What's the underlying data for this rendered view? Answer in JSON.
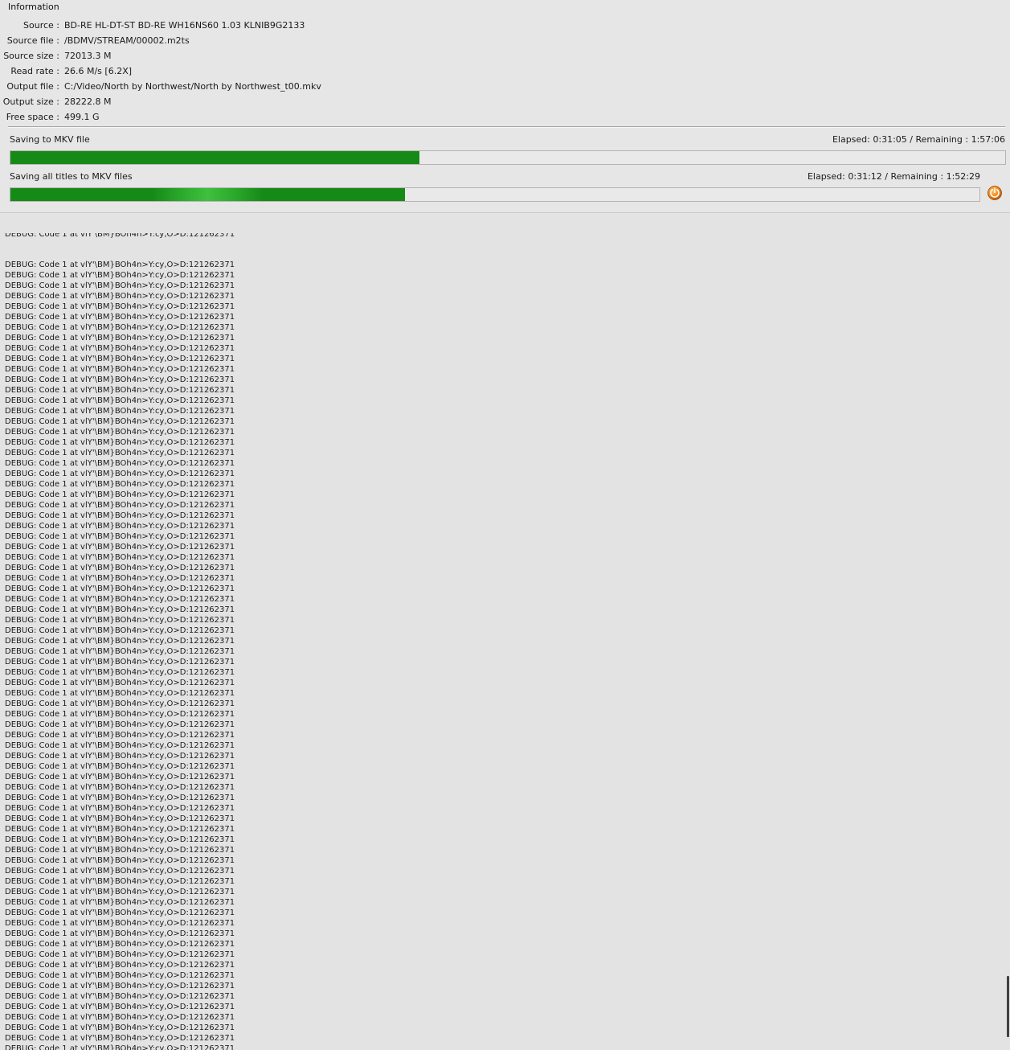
{
  "information": {
    "title": "Information",
    "rows": [
      {
        "label": "Source :",
        "value": "BD-RE HL-DT-ST BD-RE  WH16NS60 1.03 KLNIB9G2133"
      },
      {
        "label": "Source file :",
        "value": "/BDMV/STREAM/00002.m2ts"
      },
      {
        "label": "Source size :",
        "value": "72013.3 M"
      },
      {
        "label": "Read rate :",
        "value": "26.6 M/s [6.2X]"
      },
      {
        "label": "Output file :",
        "value": "C:/Video/North by Northwest/North by Northwest_t00.mkv"
      },
      {
        "label": "Output size :",
        "value": "28222.8 M"
      },
      {
        "label": "Free space :",
        "value": "499.1 G"
      }
    ]
  },
  "progress": {
    "current": {
      "caption": "Saving to MKV file",
      "elapsed": "Elapsed: 0:31:05 / Remaining : 1:57:06",
      "fraction": 0.411
    },
    "total": {
      "caption": "Saving all titles to MKV files",
      "elapsed": "Elapsed: 0:31:12 / Remaining : 1:52:29",
      "fraction": 0.407
    },
    "stop_icon": "stop-record-icon",
    "fill_color": "#168a16"
  },
  "log": {
    "line_text": "DEBUG: Code 1 at vlY'\\BM}BOh4n>Y:cy,O>D:121262371",
    "partial_top_line": "DEBUG: Code 1 at vlY'\\BM}BOh4n>Y:cy,O>D:121262371",
    "repeat_count": 78
  }
}
